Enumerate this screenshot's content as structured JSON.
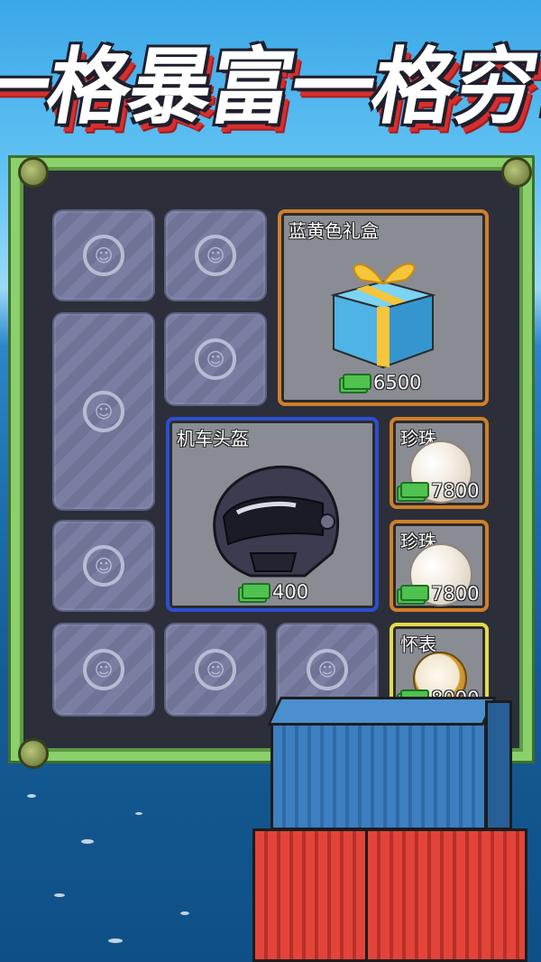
{
  "title": "一格暴富一格穷!",
  "tile_emblem": "cat-coin-icon",
  "items": [
    {
      "name": "蓝黄色礼盒",
      "price": "6500",
      "icon": "gift-box-icon"
    },
    {
      "name": "机车头盔",
      "price": "400",
      "icon": "motorcycle-helmet-icon"
    },
    {
      "name": "珍珠",
      "price": "7800",
      "icon": "pearl-icon"
    },
    {
      "name": "珍珠",
      "price": "7800",
      "icon": "pearl-icon"
    },
    {
      "name": "怀表",
      "price": "8000",
      "icon": "pocket-watch-icon"
    }
  ],
  "colors": {
    "frame_green": "#8ad06b",
    "card_orange": "#d07f2a",
    "card_blue": "#2b4fd0",
    "card_yellow": "#e6d84d",
    "container_blue": "#3d7fc0",
    "container_red": "#e2443a"
  }
}
